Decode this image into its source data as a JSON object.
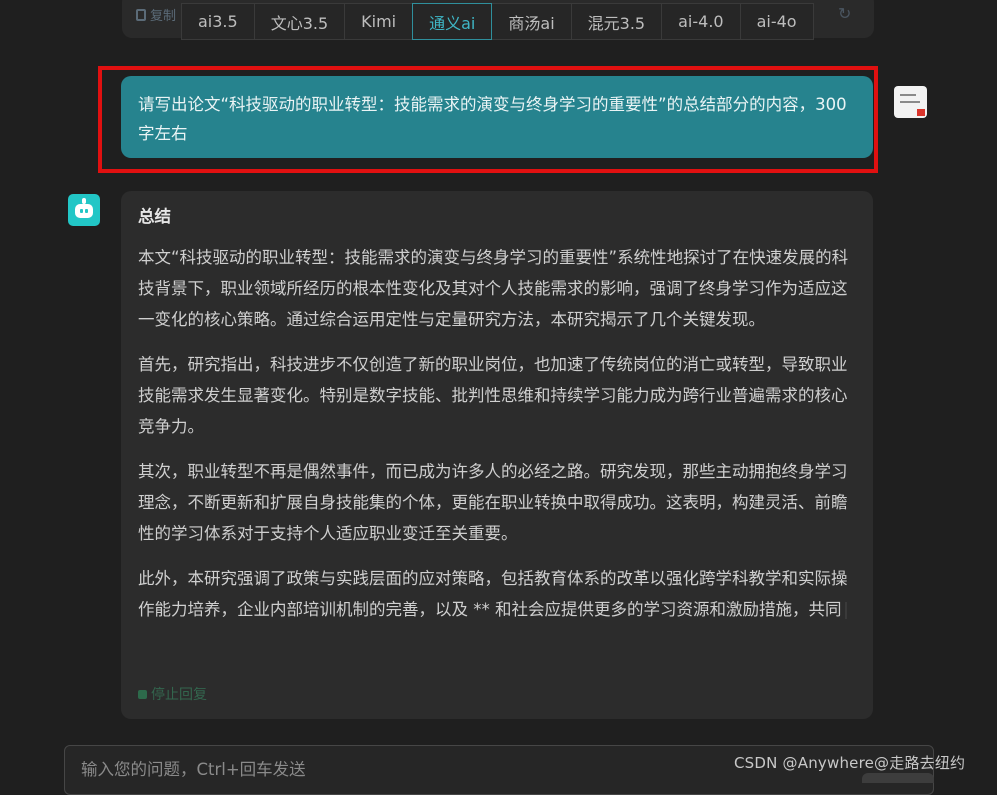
{
  "previous_message": {
    "copy_label": "复制"
  },
  "model_tabs": [
    {
      "label": "ai3.5",
      "active": false
    },
    {
      "label": "文心3.5",
      "active": false
    },
    {
      "label": "Kimi",
      "active": false
    },
    {
      "label": "通义ai",
      "active": true
    },
    {
      "label": "商汤ai",
      "active": false
    },
    {
      "label": "混元3.5",
      "active": false
    },
    {
      "label": "ai-4.0",
      "active": false
    },
    {
      "label": "ai-4o",
      "active": false
    }
  ],
  "user_message": {
    "text": "请写出论文“科技驱动的职业转型：技能需求的演变与终身学习的重要性”的总结部分的内容，300字左右"
  },
  "bot_message": {
    "title": "总结",
    "paragraphs": [
      "本文“科技驱动的职业转型：技能需求的演变与终身学习的重要性”系统性地探讨了在快速发展的科技背景下，职业领域所经历的根本性变化及其对个人技能需求的影响，强调了终身学习作为适应这一变化的核心策略。通过综合运用定性与定量研究方法，本研究揭示了几个关键发现。",
      "首先，研究指出，科技进步不仅创造了新的职业岗位，也加速了传统岗位的消亡或转型，导致职业技能需求发生显著变化。特别是数字技能、批判性思维和持续学习能力成为跨行业普遍需求的核心竞争力。",
      "其次，职业转型不再是偶然事件，而已成为许多人的必经之路。研究发现，那些主动拥抱终身学习理念，不断更新和扩展自身技能集的个体，更能在职业转换中取得成功。这表明，构建灵活、前瞻性的学习体系对于支持个人适应职业变迁至关重要。",
      "此外，本研究强调了政策与实践层面的应对策略，包括教育体系的改革以强化跨学科教学和实际操作能力培养，企业内部培训机制的完善，以及 ** 和社会应提供更多的学习资源和激励措施，共同"
    ],
    "stop_label": "停止回复"
  },
  "input": {
    "placeholder": "输入您的问题，Ctrl+回车发送",
    "value": ""
  },
  "watermark": "CSDN @Anywhere@走路去纽约",
  "colors": {
    "background": "#1f1f1f",
    "user_bubble": "#26838e",
    "bot_bubble": "#2c2c2c",
    "highlight_box": "#e01010",
    "active_tab": "#3fb7c6"
  }
}
